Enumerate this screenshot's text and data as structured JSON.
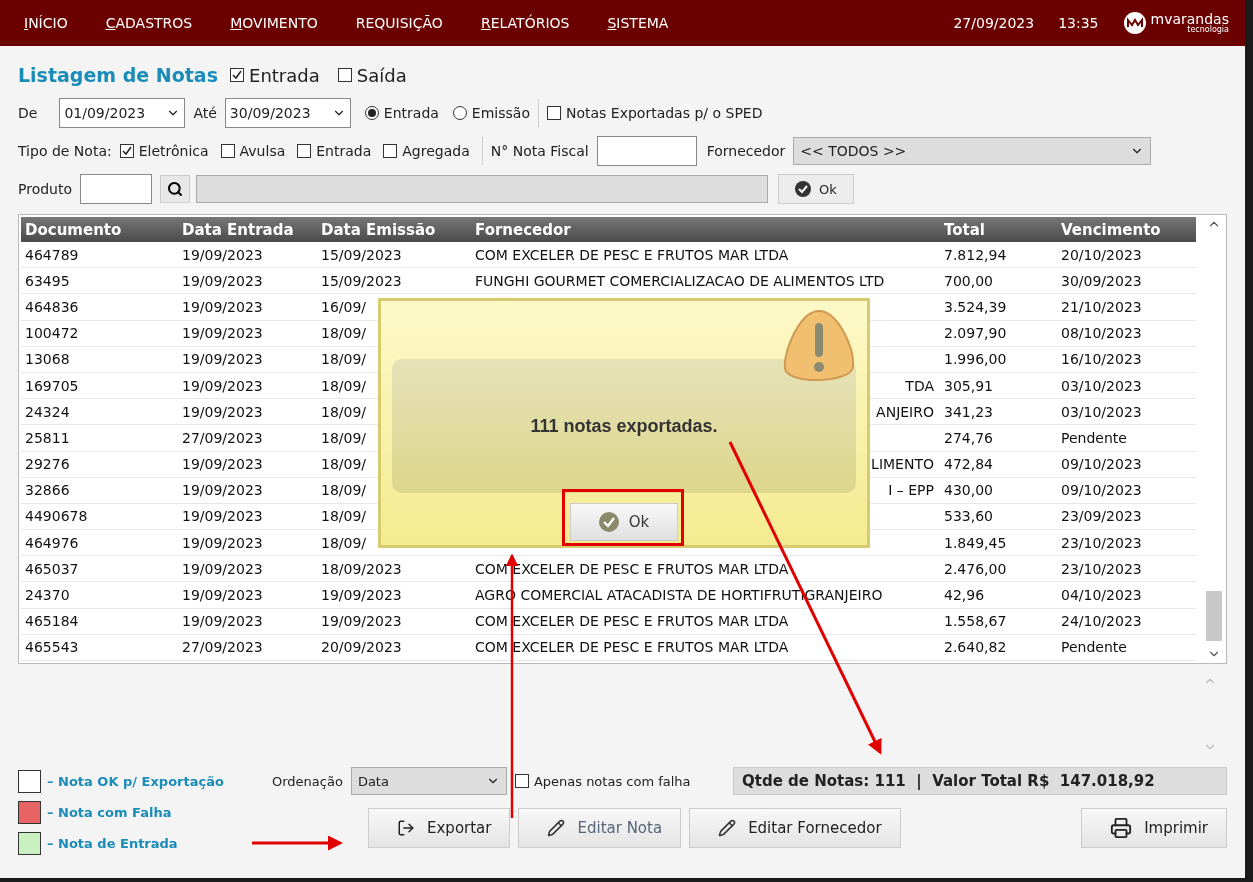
{
  "menu": {
    "items": [
      {
        "label": "INÍCIO",
        "underline_first": true
      },
      {
        "label": "CADASTROS",
        "underline_first": true
      },
      {
        "label": "MOVIMENTO",
        "underline_first": true
      },
      {
        "label": "REQUISIÇÃO",
        "underline_first": false
      },
      {
        "label": "RELATÓRIOS",
        "underline_first": true
      },
      {
        "label": "SISTEMA",
        "underline_first": true
      }
    ],
    "date": "27/09/2023",
    "time": "13:35",
    "logo": "mvarandas",
    "logo_sub": "tecnologia"
  },
  "title": "Listagem de Notas",
  "direction": [
    {
      "label": "Entrada",
      "checked": true
    },
    {
      "label": "Saída",
      "checked": false
    }
  ],
  "period": {
    "from_label": "De",
    "from": "01/09/2023",
    "to_label": "Até",
    "to": "30/09/2023",
    "basis": [
      {
        "label": "Entrada",
        "selected": true
      },
      {
        "label": "Emissão",
        "selected": false
      }
    ],
    "sped": {
      "label": "Notas Exportadas p/ o SPED",
      "checked": false
    }
  },
  "types": {
    "label": "Tipo de Nota:",
    "options": [
      {
        "label": "Eletrônica",
        "checked": true
      },
      {
        "label": "Avulsa",
        "checked": false
      },
      {
        "label": "Entrada",
        "checked": false
      },
      {
        "label": "Agregada",
        "checked": false
      }
    ],
    "nf_label": "N° Nota Fiscal",
    "supplier_label": "Fornecedor",
    "supplier": "<< TODOS >>"
  },
  "product": {
    "label": "Produto",
    "ok": "Ok"
  },
  "table": {
    "columns": [
      "Documento",
      "Data Entrada",
      "Data Emissão",
      "Fornecedor",
      "Total",
      "Vencimento"
    ],
    "rows": [
      {
        "documento": "464789",
        "data_entrada": "19/09/2023",
        "data_emissao": "15/09/2023",
        "fornecedor": "COM EXCELER DE PESC E FRUTOS MAR LTDA",
        "total": "7.812,94",
        "vencimento": "20/10/2023"
      },
      {
        "documento": "63495",
        "data_entrada": "19/09/2023",
        "data_emissao": "15/09/2023",
        "fornecedor": "FUNGHI GOURMET COMERCIALIZACAO DE ALIMENTOS LTD",
        "total": "700,00",
        "vencimento": "30/09/2023"
      },
      {
        "documento": "464836",
        "data_entrada": "19/09/2023",
        "data_emissao": "16/09/",
        "total": "3.524,39",
        "vencimento": "21/10/2023"
      },
      {
        "documento": "100472",
        "data_entrada": "19/09/2023",
        "data_emissao": "18/09/",
        "total": "2.097,90",
        "vencimento": "08/10/2023"
      },
      {
        "documento": "13068",
        "data_entrada": "19/09/2023",
        "data_emissao": "18/09/",
        "total": "1.996,00",
        "vencimento": "16/10/2023"
      },
      {
        "documento": "169705",
        "data_entrada": "19/09/2023",
        "data_emissao": "18/09/",
        "fornecedor_tail": "TDA",
        "total": "305,91",
        "vencimento": "03/10/2023"
      },
      {
        "documento": "24324",
        "data_entrada": "19/09/2023",
        "data_emissao": "18/09/",
        "fornecedor_tail": "ANJEIRO",
        "total": "341,23",
        "vencimento": "03/10/2023"
      },
      {
        "documento": "25811",
        "data_entrada": "27/09/2023",
        "data_emissao": "18/09/",
        "total": "274,76",
        "vencimento": "Pendente"
      },
      {
        "documento": "29276",
        "data_entrada": "19/09/2023",
        "data_emissao": "18/09/",
        "fornecedor_tail": "LIMENTO",
        "total": "472,84",
        "vencimento": "09/10/2023"
      },
      {
        "documento": "32866",
        "data_entrada": "19/09/2023",
        "data_emissao": "18/09/",
        "fornecedor_tail": "I – EPP",
        "total": "430,00",
        "vencimento": "09/10/2023"
      },
      {
        "documento": "4490678",
        "data_entrada": "19/09/2023",
        "data_emissao": "18/09/",
        "total": "533,60",
        "vencimento": "23/09/2023"
      },
      {
        "documento": "464976",
        "data_entrada": "19/09/2023",
        "data_emissao": "18/09/",
        "total": "1.849,45",
        "vencimento": "23/10/2023"
      },
      {
        "documento": "465037",
        "data_entrada": "19/09/2023",
        "data_emissao": "18/09/2023",
        "fornecedor": "COM EXCELER DE PESC E FRUTOS MAR LTDA",
        "total": "2.476,00",
        "vencimento": "23/10/2023"
      },
      {
        "documento": "24370",
        "data_entrada": "19/09/2023",
        "data_emissao": "19/09/2023",
        "fornecedor": "AGRO COMERCIAL ATACADISTA DE HORTIFRUTIGRANJEIRO",
        "total": "42,96",
        "vencimento": "04/10/2023"
      },
      {
        "documento": "465184",
        "data_entrada": "19/09/2023",
        "data_emissao": "19/09/2023",
        "fornecedor": "COM EXCELER DE PESC E FRUTOS MAR LTDA",
        "total": "1.558,67",
        "vencimento": "24/10/2023"
      },
      {
        "documento": "465543",
        "data_entrada": "27/09/2023",
        "data_emissao": "20/09/2023",
        "fornecedor": "COM EXCELER DE PESC E FRUTOS MAR LTDA",
        "total": "2.640,82",
        "vencimento": "Pendente"
      }
    ]
  },
  "dialog": {
    "message": "111 notas exportadas.",
    "ok": "Ok"
  },
  "legend": [
    {
      "label": "– Nota OK p/ Exportação",
      "color": "#ffffff"
    },
    {
      "label": "– Nota com Falha",
      "color": "#e86464"
    },
    {
      "label": "– Nota de Entrada",
      "color": "#c8f0c0"
    }
  ],
  "order": {
    "label": "Ordenação",
    "value": "Data"
  },
  "only_failed": {
    "label": "Apenas notas com falha",
    "checked": false
  },
  "summary": "Qtde de Notas: 111  |  Valor Total R$  147.018,92",
  "buttons": [
    {
      "label": "Exportar",
      "kind": "export",
      "disabled": false
    },
    {
      "label": "Editar Nota",
      "kind": "edit",
      "disabled": true
    },
    {
      "label": "Editar Fornecedor",
      "kind": "edit",
      "disabled": false
    },
    {
      "label": "Imprimir",
      "kind": "print",
      "disabled": false
    }
  ]
}
